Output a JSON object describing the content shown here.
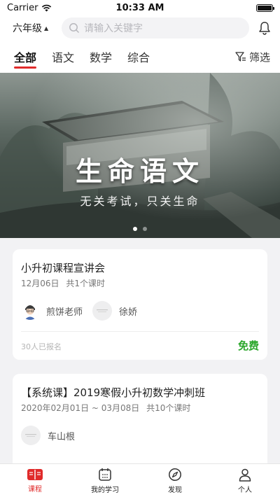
{
  "status_bar": {
    "carrier": "Carrier",
    "time": "10:33 AM"
  },
  "header": {
    "grade": "六年级",
    "search_placeholder": "请输入关键字"
  },
  "tabs": [
    {
      "label": "全部",
      "active": true
    },
    {
      "label": "语文",
      "active": false
    },
    {
      "label": "数学",
      "active": false
    },
    {
      "label": "综合",
      "active": false
    }
  ],
  "filter_label": "筛选",
  "banner": {
    "title": "生命语文",
    "subtitle": "无关考试，只关生命",
    "slide_count": 2,
    "active_slide": 1
  },
  "courses": [
    {
      "title": "小升初课程宣讲会",
      "date": "12月06日",
      "lessons": "共1个课时",
      "teachers": [
        "煎饼老师",
        "徐娇"
      ],
      "enrolled": "30人已报名",
      "price": "免费"
    },
    {
      "title": "【系统课】2019寒假小升初数学冲刺班",
      "date": "2020年02月01日 ~ 03月08日",
      "lessons": "共10个课时",
      "teachers": [
        "车山根"
      ]
    }
  ],
  "bottom_nav": [
    {
      "label": "课程",
      "icon": "course-icon",
      "active": true
    },
    {
      "label": "我的学习",
      "icon": "calendar-icon",
      "active": false
    },
    {
      "label": "发现",
      "icon": "compass-icon",
      "active": false
    },
    {
      "label": "个人",
      "icon": "person-icon",
      "active": false
    }
  ],
  "colors": {
    "accent": "#e02a2a",
    "free": "#2aa62a",
    "background": "#f2f2f4"
  }
}
